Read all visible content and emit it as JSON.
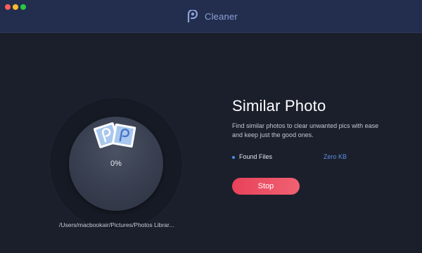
{
  "window": {
    "title": "Cleaner",
    "controls": [
      "close",
      "minimize",
      "maximize"
    ]
  },
  "icons": {
    "app_logo": "cleaner-logo-icon",
    "scan_visual": "similar-photos-icon"
  },
  "scan": {
    "progress_text": "0%",
    "progress_fraction": 0,
    "current_path": "/Users/macbookair/Pictures/Photos Librar..."
  },
  "panel": {
    "heading": "Similar Photo",
    "description": "Find similar photos to clear unwanted pics with ease and keep just the good ones.",
    "found_label": "Found Files",
    "found_size": "Zero KB",
    "stop_label": "Stop"
  },
  "colors": {
    "background": "#1b1f2c",
    "titlebar": "#232d4d",
    "accent_blue": "#5b8fe0",
    "button_red": "#e8425a"
  }
}
